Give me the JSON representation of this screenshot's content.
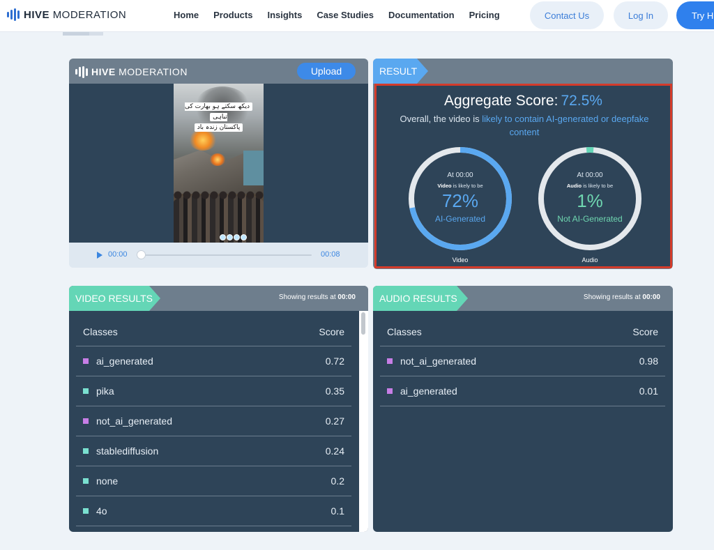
{
  "nav": {
    "brand_bold": "HIVE",
    "brand_rest": "MODERATION",
    "links": [
      "Home",
      "Products",
      "Insights",
      "Case Studies",
      "Documentation",
      "Pricing"
    ],
    "contact_label": "Contact Us",
    "login_label": "Log In",
    "try_label": "Try H"
  },
  "player": {
    "logo_bold": "HIVE",
    "logo_rest": "MODERATION",
    "upload_label": "Upload",
    "caption_line1": "دیکھ سکتے ہو بھارت کی تباہی",
    "caption_line2": "پاکستان زندہ باد",
    "time_current": "00:00",
    "time_end": "00:08"
  },
  "result": {
    "tab_label": "RESULT",
    "aggregate_label": "Aggregate Score:",
    "aggregate_value": "72.5%",
    "desc_prefix": "Overall, the video is",
    "desc_highlight": "likely to contain AI-generated or deepfake content",
    "video": {
      "at": "At 00:00",
      "kind": "Video",
      "likely": "is likely to be",
      "percent": "72%",
      "fraction": 0.72,
      "verdict": "AI-Generated",
      "caption": "Video"
    },
    "audio": {
      "at": "At 00:00",
      "kind": "Audio",
      "likely": "is likely to be",
      "percent": "1%",
      "fraction": 0.01,
      "verdict": "Not AI-Generated",
      "caption": "Audio"
    }
  },
  "video_results": {
    "tab_label": "VIDEO RESULTS",
    "showing_prefix": "Showing results at",
    "showing_time": "00:00",
    "col_classes": "Classes",
    "col_score": "Score",
    "rows": [
      {
        "name": "ai_generated",
        "score": "0.72",
        "color": "purple"
      },
      {
        "name": "pika",
        "score": "0.35",
        "color": "teal"
      },
      {
        "name": "not_ai_generated",
        "score": "0.27",
        "color": "purple"
      },
      {
        "name": "stablediffusion",
        "score": "0.24",
        "color": "teal"
      },
      {
        "name": "none",
        "score": "0.2",
        "color": "teal"
      },
      {
        "name": "4o",
        "score": "0.1",
        "color": "teal"
      }
    ]
  },
  "audio_results": {
    "tab_label": "AUDIO RESULTS",
    "showing_prefix": "Showing results at",
    "showing_time": "00:00",
    "col_classes": "Classes",
    "col_score": "Score",
    "rows": [
      {
        "name": "not_ai_generated",
        "score": "0.98",
        "color": "purple"
      },
      {
        "name": "ai_generated",
        "score": "0.01",
        "color": "purple"
      }
    ]
  },
  "colors": {
    "accent_blue": "#5aa8f0",
    "accent_teal": "#64d6b6",
    "panel_bg": "#2e4458",
    "highlight_border": "#d43b2a"
  }
}
